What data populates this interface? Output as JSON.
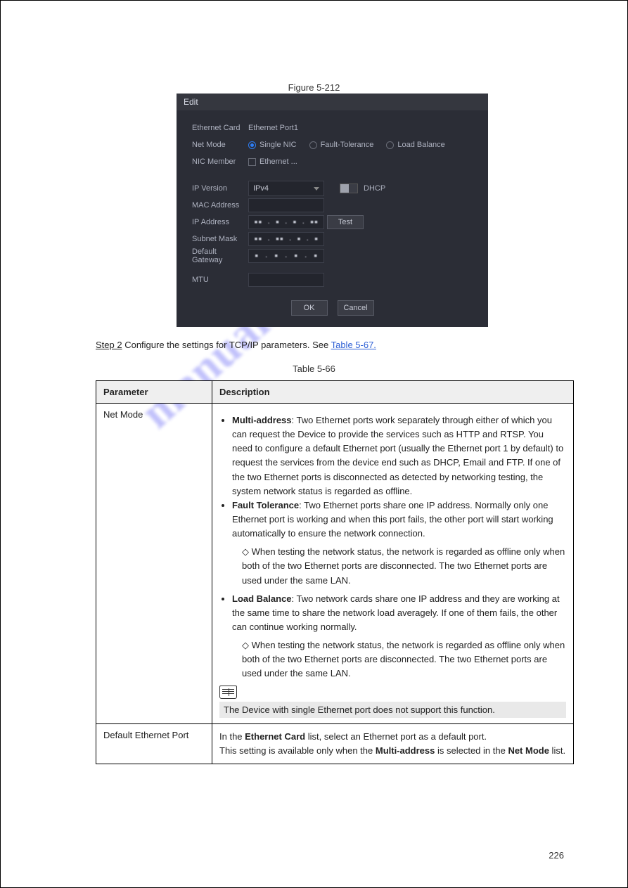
{
  "figure_caption": "Figure 5-212",
  "dialog": {
    "title": "Edit",
    "labels": {
      "ethernet_card": "Ethernet Card",
      "ethernet_card_value": "Ethernet Port1",
      "net_mode": "Net Mode",
      "single_nic": "Single NIC",
      "fault_tolerance": "Fault-Tolerance",
      "load_balance": "Load Balance",
      "nic_member": "NIC Member",
      "nic_member_checkbox": "Ethernet ...",
      "ip_version": "IP Version",
      "ip_version_value": "IPv4",
      "dhcp": "DHCP",
      "mac_address": "MAC Address",
      "mac_placeholder": "",
      "ip_address": "IP Address",
      "test": "Test",
      "subnet_mask": "Subnet Mask",
      "default_gateway": "Default Gateway",
      "mtu": "MTU",
      "mtu_placeholder": "",
      "ok": "OK",
      "cancel": "Cancel"
    }
  },
  "step2": {
    "prefix": "Step 2",
    "text": "   Configure the settings for TCP/IP parameters. See ",
    "link": "Table 5-67.",
    "after": ""
  },
  "table_caption": "Table 5-66",
  "table": {
    "headers": [
      "Parameter",
      "Description"
    ],
    "rows": [
      {
        "param": "Net Mode",
        "desc_html": "net_mode"
      },
      {
        "param": "Default Ethernet Port",
        "desc_html": "default_port"
      }
    ]
  },
  "net_mode_desc": {
    "li1_title": "Multi-address",
    "li1_text": ": Two Ethernet ports work separately through either of which you can request the Device to provide the services such as HTTP and RTSP. You need to configure a default Ethernet port (usually the Ethernet port 1 by default) to request the services from the device end such as DHCP, Email and FTP. If one of the two Ethernet ports is disconnected as detected by networking testing, the system network status is regarded as offline.",
    "li2_title": "Fault Tolerance",
    "li2_text": ": Two Ethernet ports share one IP address. Normally only one Ethernet port is working and when this port fails, the other port will start working automatically to ensure the network connection.",
    "li2_sub1": "When testing the network status, the network is regarded as offline only when both of the two Ethernet ports are disconnected. The two Ethernet ports are used under the same LAN.",
    "li3_title": "Load Balance",
    "li3_text": ": Two network cards share one IP address and they are working at the same time to share the network load averagely. If one of them fails, the other can continue working normally.",
    "li3_sub1": "When testing the network status, the network is regarded as offline only when both of the two Ethernet ports are disconnected. The two Ethernet ports are used under the same LAN.",
    "note": "The Device with single Ethernet port does not support this function."
  },
  "default_port_desc": {
    "line1": "In the ",
    "bold1": "Ethernet Card",
    "line2": " list, select an Ethernet port as a default port.",
    "line3": "This setting is available only when the ",
    "bold2": "Multi-address",
    "line4": " is selected in the ",
    "bold3": "Net Mode",
    "line5": " list."
  },
  "watermark": "manualshive.com",
  "page_number": "226"
}
